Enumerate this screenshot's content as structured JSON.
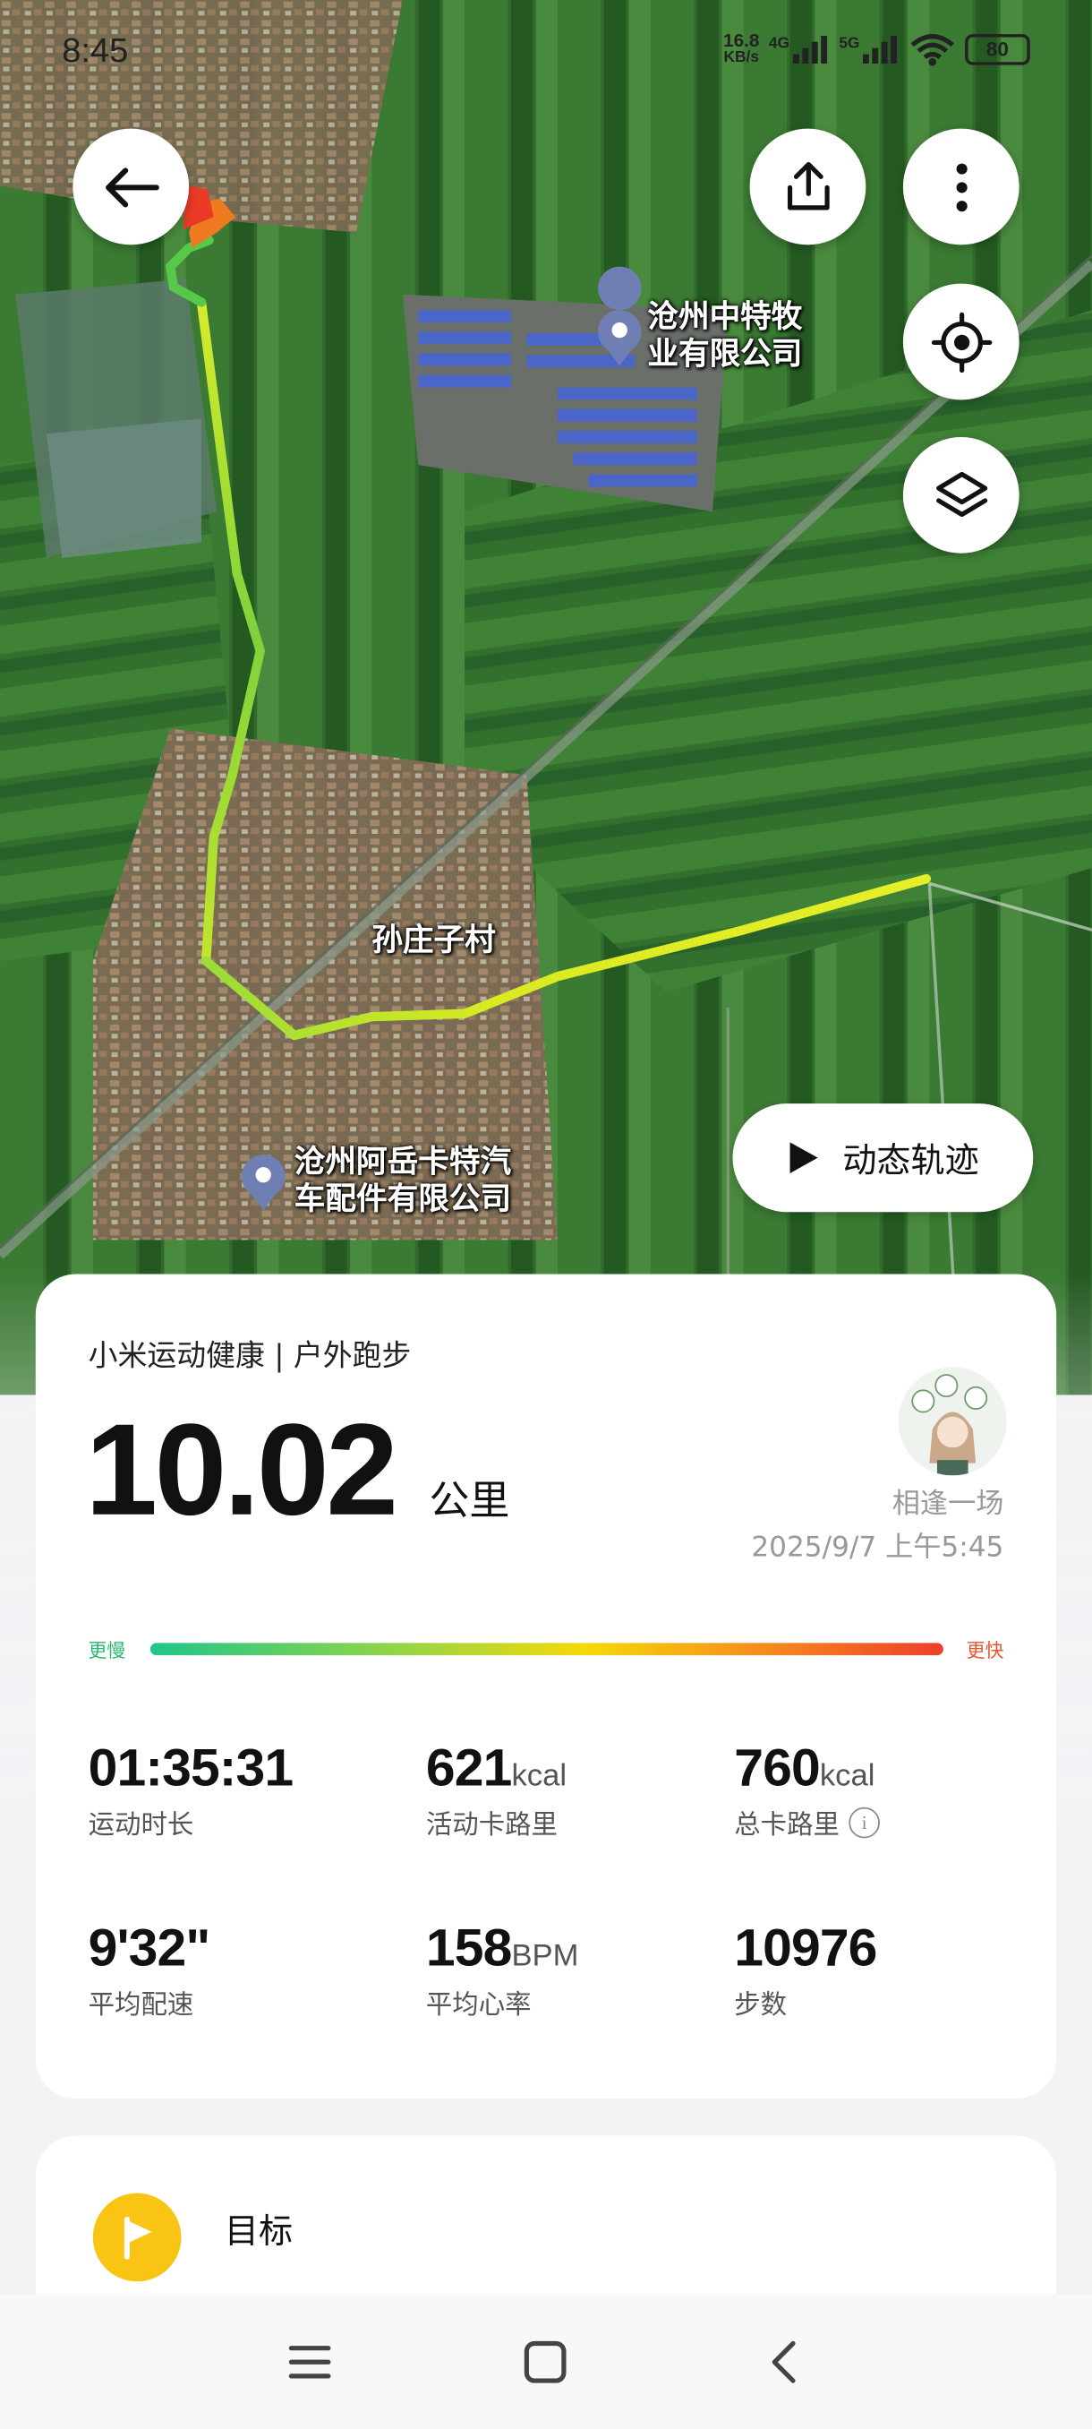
{
  "status_bar": {
    "time": "8:45",
    "net_speed_top": "16.8",
    "net_speed_bottom": "KB/s",
    "signal1_label": "4G",
    "signal2_label": "5G",
    "battery": "80"
  },
  "map": {
    "labels": {
      "company1_line1": "沧州中特牧",
      "company1_line2": "业有限公司",
      "village": "孙庄子村",
      "company2_line1": "沧州阿岳卡特汽",
      "company2_line2": "车配件有限公司"
    },
    "play_track_label": "动态轨迹",
    "icons": [
      "back-arrow-icon",
      "share-icon",
      "more-icon",
      "locate-icon",
      "layers-icon",
      "play-icon"
    ]
  },
  "summary": {
    "source": "小米运动健康 | 户外跑步",
    "distance": "10.02",
    "distance_unit": "公里",
    "user_name": "相逢一场",
    "datetime": "2025/9/7 上午5:45",
    "pace_slow": "更慢",
    "pace_fast": "更快",
    "stats": [
      {
        "value": "01:35:31",
        "unit": "",
        "label": "运动时长"
      },
      {
        "value": "621",
        "unit": "kcal",
        "label": "活动卡路里"
      },
      {
        "value": "760",
        "unit": "kcal",
        "label": "总卡路里"
      },
      {
        "value": "9'32\"",
        "unit": "",
        "label": "平均配速"
      },
      {
        "value": "158",
        "unit": "BPM",
        "label": "平均心率"
      },
      {
        "value": "10976",
        "unit": "",
        "label": "步数"
      }
    ],
    "info_icon": "i"
  },
  "goal": {
    "label": "目标"
  },
  "colors": {
    "route_slow": "#20c58a",
    "route_fast": "#ec3f2c",
    "goal_icon_bg": "#f9c413"
  }
}
